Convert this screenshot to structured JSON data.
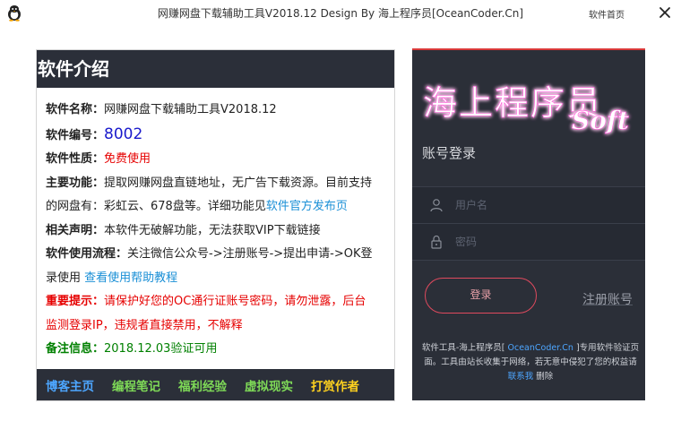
{
  "window": {
    "title": "网赚网盘下载辅助工具V2018.12   Design  By 海上程序员[OceanCoder.Cn]",
    "home_label": "软件首页"
  },
  "intro": {
    "header": "软件介绍",
    "name_key": "软件名称：",
    "name_val": "网赚网盘下载辅助工具V2018.12",
    "id_key": "软件编号：",
    "id_val": "8002",
    "nature_key": "软件性质：",
    "nature_val": "免费使用",
    "func_key": "主要功能：",
    "func_val1": "提取网赚网盘直链地址，无广告下载资源。目前支持",
    "func_val2": "的网盘有：彩虹云、678盘等。详细功能见",
    "func_link": "软件官方发布页",
    "decl_key": "相关声明：",
    "decl_val": "本软件无破解功能，无法获取VIP下载链接",
    "flow_key": "软件使用流程：",
    "flow_val1": "关注微信公众号->注册账号->提出申请->OK登",
    "flow_val2": "录使用 ",
    "flow_link": "查看使用帮助教程",
    "warn_key": "重要提示：",
    "warn_val1": "请保护好您的OC通行证账号密码，请勿泄露，后台",
    "warn_val2": "监测登录IP，违规者直接禁用，不解释",
    "note_key": "备注信息：",
    "note_val": "2018.12.03验证可用"
  },
  "bottom_links": [
    {
      "label": "博客主页",
      "color": "#4da6ff"
    },
    {
      "label": "编程笔记",
      "color": "#7ed957"
    },
    {
      "label": "福利经验",
      "color": "#7ed957"
    },
    {
      "label": "虚拟现实",
      "color": "#7ed957"
    },
    {
      "label": "打赏作者",
      "color": "#ffd21f"
    }
  ],
  "login": {
    "logo_text": "海上程序员",
    "logo_soft": "Soft",
    "title": "账号登录",
    "username_placeholder": "用户名",
    "password_placeholder": "密码",
    "login_button": "登录",
    "register_link": "注册账号",
    "footer_line1": "软件工具-海上程序员[ ",
    "footer_site": "OceanCoder.Cn",
    "footer_line2": " ]专用软件验证页面。工具由站长收集于网络，若无意中侵犯了您的权益请 ",
    "footer_contact": "联系我",
    "footer_line3": " 删除"
  },
  "colors": {
    "panel_dark": "#2b2f39",
    "accent_red": "#e60000",
    "link_blue": "#1a8fd6",
    "login_border": "#e04a5e"
  }
}
